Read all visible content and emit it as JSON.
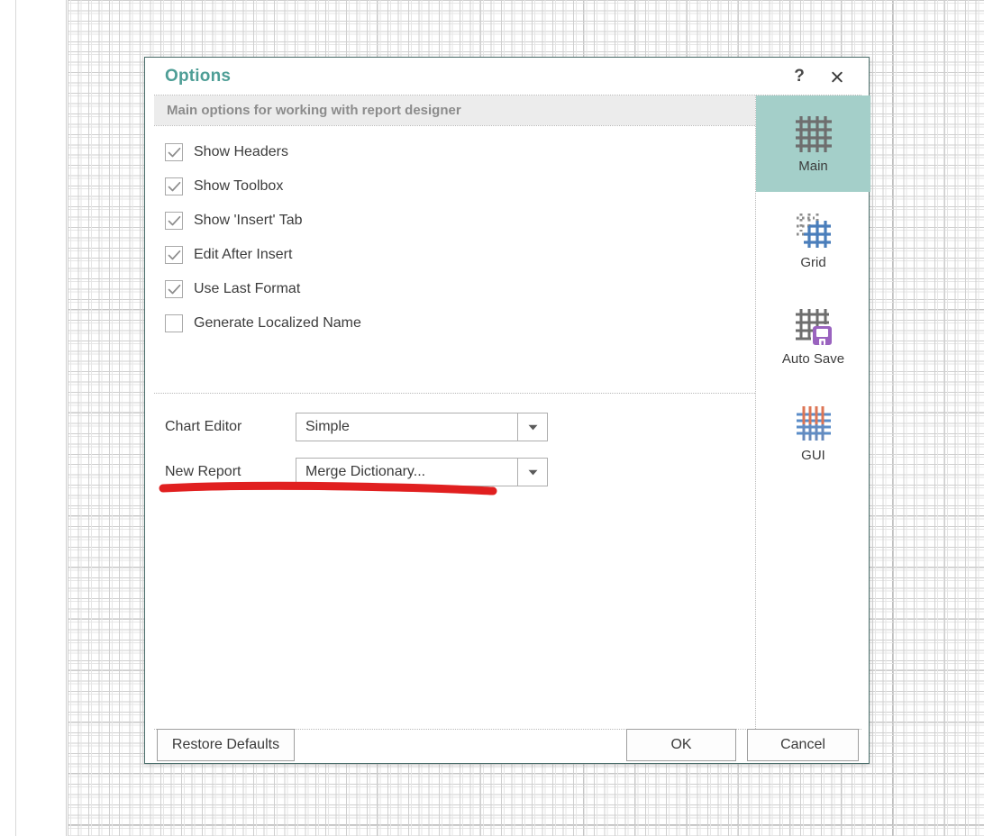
{
  "window": {
    "title": "Options",
    "help_icon": "question-mark-icon",
    "close_icon": "close-icon",
    "help_label": "?",
    "border_color": "#4c6f6c",
    "title_color": "#4e9e96"
  },
  "subtitle": "Main options for working with report designer",
  "checkboxes": [
    {
      "label": "Show Headers",
      "checked": true
    },
    {
      "label": "Show Toolbox",
      "checked": true
    },
    {
      "label": "Show 'Insert' Tab",
      "checked": true
    },
    {
      "label": "Edit After Insert",
      "checked": true
    },
    {
      "label": "Use Last Format",
      "checked": true
    },
    {
      "label": "Generate Localized Name",
      "checked": false
    }
  ],
  "fields": [
    {
      "label": "Chart Editor",
      "value": "Simple",
      "arrow_icon": "chevron-down-icon"
    },
    {
      "label": "New Report",
      "value": "Merge Dictionary...",
      "arrow_icon": "chevron-down-icon"
    }
  ],
  "rail": [
    {
      "label": "Main",
      "icon": "grid-main-icon",
      "active": true
    },
    {
      "label": "Grid",
      "icon": "grid-blue-icon",
      "active": false
    },
    {
      "label": "Auto Save",
      "icon": "grid-floppy-icon",
      "active": false
    },
    {
      "label": "GUI",
      "icon": "grid-color-icon",
      "active": false
    }
  ],
  "footer": {
    "restore": "Restore Defaults",
    "ok": "OK",
    "cancel": "Cancel"
  },
  "annotation": {
    "type": "red-underline-stroke",
    "color": "#e02020"
  },
  "colors": {
    "accent_teal": "#4e9e96",
    "rail_active": "#a4cfc9",
    "band_gray": "#ececec",
    "annotation_red": "#e02020"
  }
}
